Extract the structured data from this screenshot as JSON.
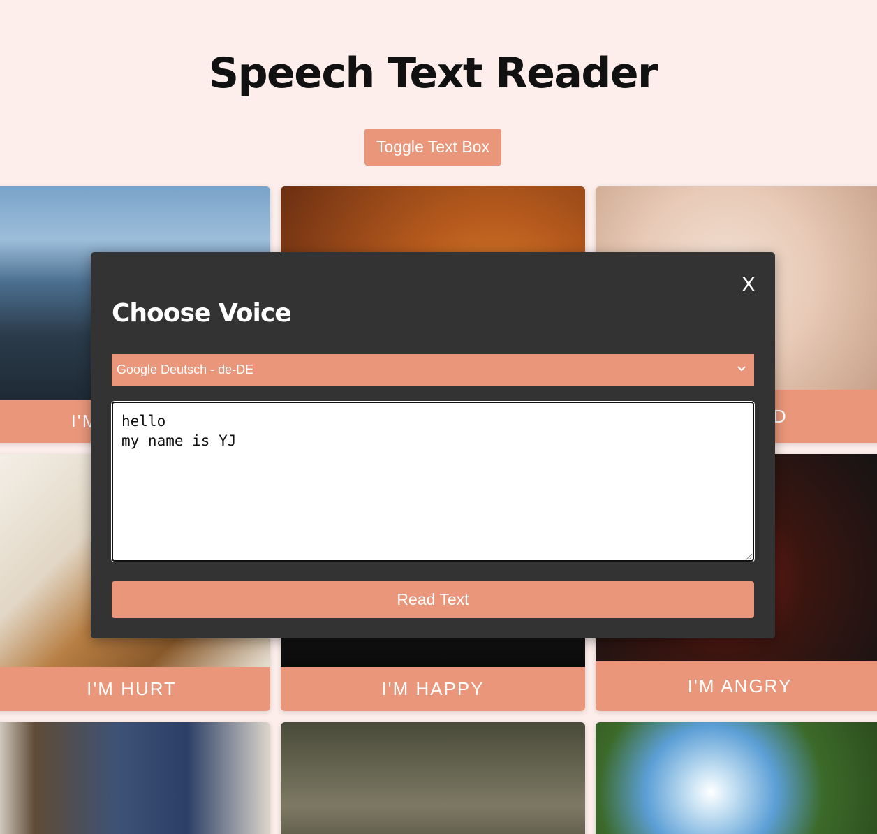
{
  "header": {
    "title": "Speech Text Reader",
    "toggle_label": "Toggle Text Box"
  },
  "cards": [
    {
      "label": "I'M THIRSTY",
      "image": "water-pouring-photo"
    },
    {
      "label": "",
      "image": "pizza-photo"
    },
    {
      "label": "I'M TIRED",
      "image": "sleeping-child-photo"
    },
    {
      "label": "I'M HURT",
      "image": "teddy-bear-photo"
    },
    {
      "label": "I'M HAPPY",
      "image": "smiling-face-photo"
    },
    {
      "label": "I'M ANGRY",
      "image": "angry-child-photo"
    },
    {
      "label": "",
      "image": "crying-child-photo"
    },
    {
      "label": "",
      "image": "child-on-path-photo"
    },
    {
      "label": "",
      "image": "sun-through-trees-photo"
    }
  ],
  "modal": {
    "close_label": "X",
    "heading": "Choose Voice",
    "selected_voice": "Google Deutsch - de-DE",
    "text_value": "hello\nmy name is YJ",
    "read_label": "Read Text"
  },
  "colors": {
    "background": "#fdeeeb",
    "accent": "#e9967a",
    "modal": "#333333"
  }
}
